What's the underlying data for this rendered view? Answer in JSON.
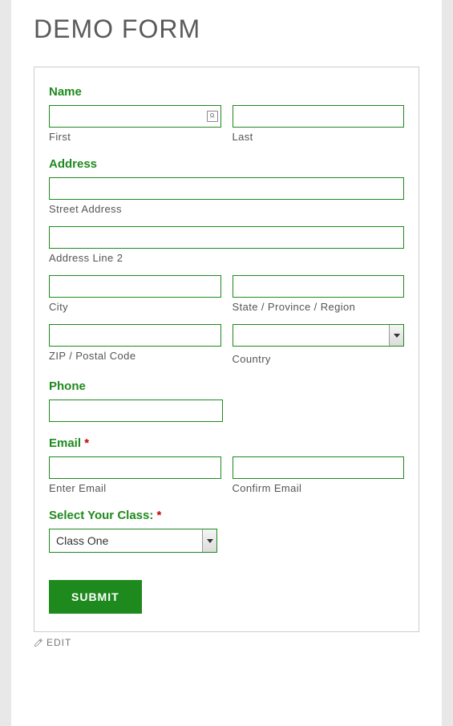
{
  "title": "DEMO FORM",
  "name": {
    "section": "Name",
    "first_label": "First",
    "last_label": "Last"
  },
  "address": {
    "section": "Address",
    "street_label": "Street Address",
    "line2_label": "Address Line 2",
    "city_label": "City",
    "state_label": "State / Province / Region",
    "zip_label": "ZIP / Postal Code",
    "country_label": "Country"
  },
  "phone": {
    "section": "Phone"
  },
  "email": {
    "section": "Email",
    "required_mark": "*",
    "enter_label": "Enter Email",
    "confirm_label": "Confirm Email"
  },
  "class": {
    "section": "Select Your Class:",
    "required_mark": "*",
    "selected": "Class One"
  },
  "submit_label": "SUBMIT",
  "edit_label": "EDIT"
}
